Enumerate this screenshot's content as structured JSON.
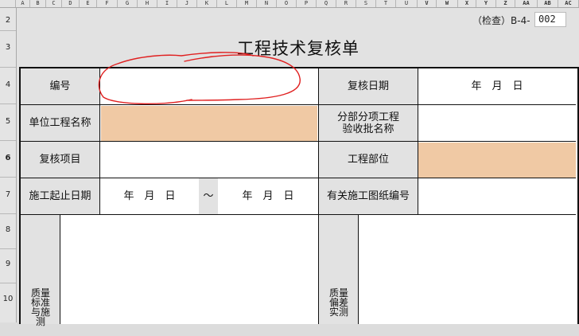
{
  "grid": {
    "columns": [
      "A",
      "B",
      "C",
      "D",
      "E",
      "F",
      "G",
      "H",
      "I",
      "J",
      "K",
      "L",
      "M",
      "N",
      "O",
      "P",
      "Q",
      "R",
      "S",
      "T",
      "U",
      "V",
      "W",
      "X",
      "Y",
      "Z",
      "AA",
      "AB",
      "AC"
    ],
    "rows": [
      "2",
      "3",
      "4",
      "5",
      "6",
      "7",
      "8",
      "9",
      "10"
    ]
  },
  "form": {
    "code_label": "（检查）B-4-",
    "code_value": "002",
    "title": "工程技术复核单",
    "labels": {
      "number": "编号",
      "review_date": "复核日期",
      "unit_project_name": "单位工程名称",
      "sub_project_name_line1": "分部分项工程",
      "sub_project_name_line2": "验收批名称",
      "review_item": "复核项目",
      "project_location": "工程部位",
      "construction_dates": "施工起止日期",
      "drawing_number": "有关施工图纸编号",
      "quality_standard": "质量标准与施测",
      "quality_deviation": "质量偏差实测"
    },
    "values": {
      "review_date": "年　月　日",
      "start_date": "年　月　日",
      "date_separator": "～",
      "end_date": "年　月　日",
      "number": "",
      "unit_project_name": "",
      "sub_project_name": "",
      "review_item": "",
      "project_location": "",
      "drawing_number": ""
    }
  },
  "colors": {
    "highlight": "#f0c9a4",
    "annotation": "#e02020",
    "header_bg": "#e4e4e4"
  }
}
